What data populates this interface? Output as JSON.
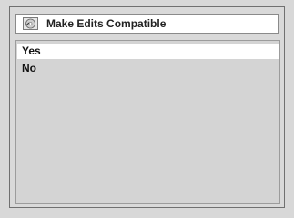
{
  "dialog": {
    "title": "Make Edits Compatible",
    "title_icon": "disc-icon",
    "options": [
      {
        "label": "Yes",
        "selected": true
      },
      {
        "label": "No",
        "selected": false
      }
    ]
  },
  "colors": {
    "background": "#d8d8d8",
    "selected_row": "#ffffff",
    "text": "#111111"
  }
}
